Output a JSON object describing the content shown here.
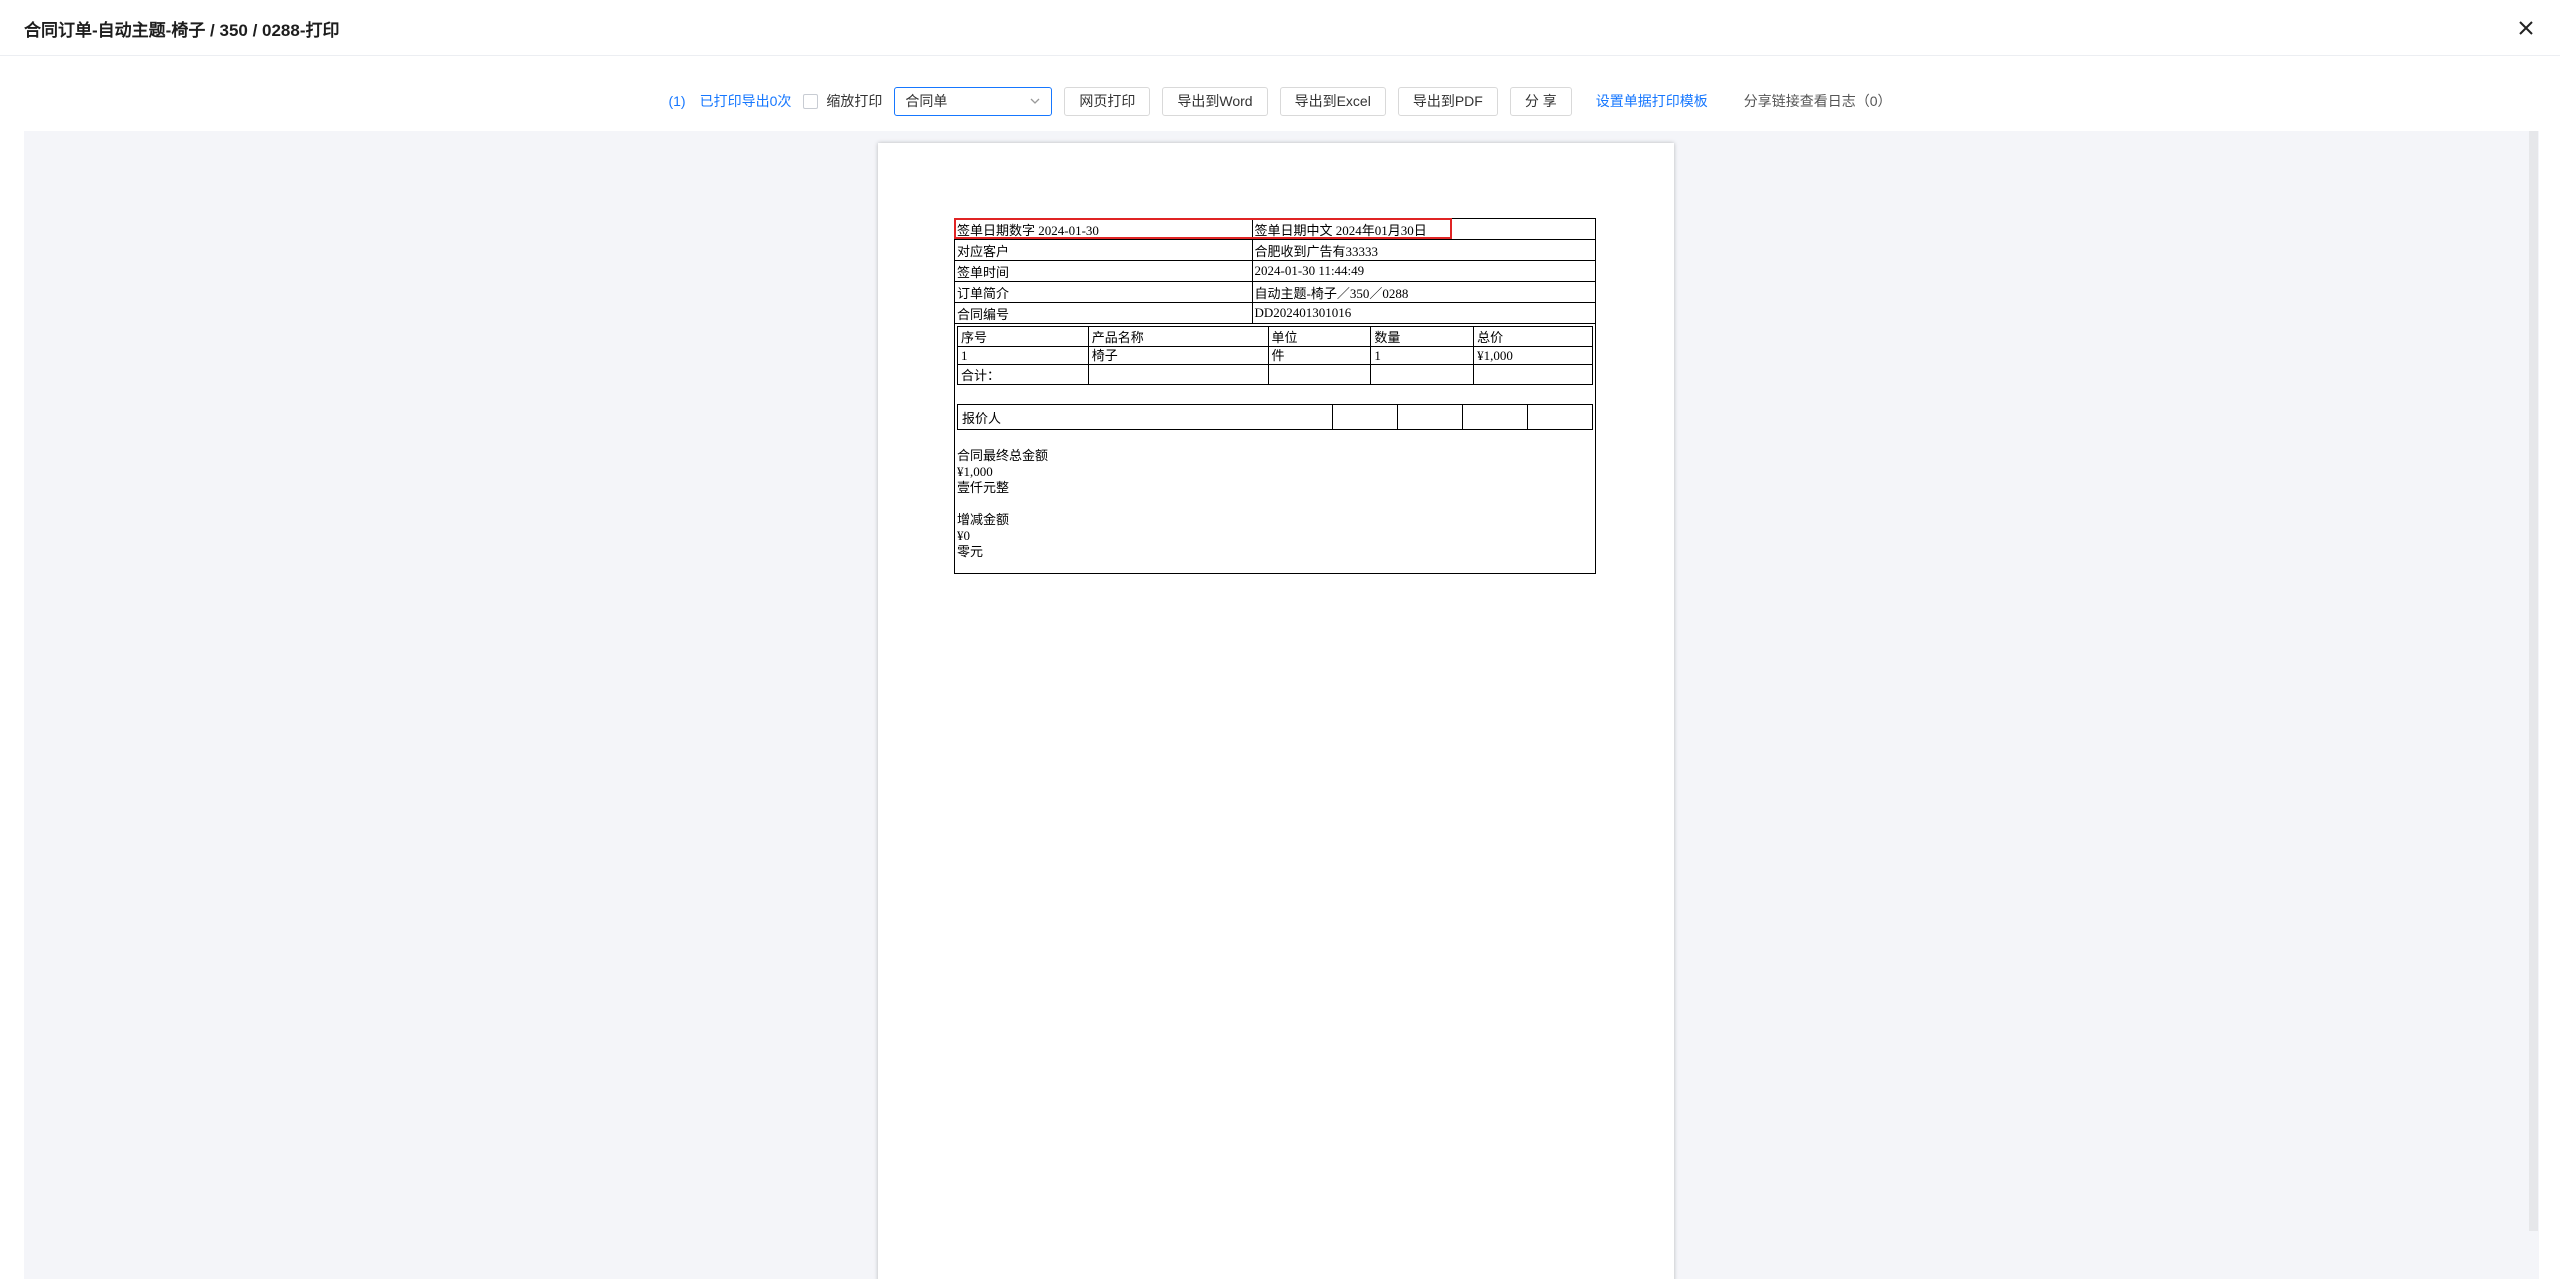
{
  "window": {
    "title": "合同订单-自动主题-椅子 / 350 / 0288-打印"
  },
  "toolbar": {
    "count_link": "(1)",
    "printed_link": "已打印导出0次",
    "scale_print_label": "缩放打印",
    "template_select_value": "合同单",
    "web_print": "网页打印",
    "export_word": "导出到Word",
    "export_excel": "导出到Excel",
    "export_pdf": "导出到PDF",
    "share": "分 享",
    "set_template": "设置单据打印模板",
    "share_log": "分享链接查看日志（0）"
  },
  "doc": {
    "header_rows": [
      {
        "label": "签单日期数字 2024-01-30",
        "value": "签单日期中文 2024年01月30日"
      },
      {
        "label": "对应客户",
        "value": "合肥收到广告有33333"
      },
      {
        "label": "签单时间",
        "value": "2024-01-30 11:44:49"
      },
      {
        "label": "订单简介",
        "value": "自动主题-椅子／350／0288"
      },
      {
        "label": "合同编号",
        "value": "DD202401301016"
      }
    ],
    "items_headers": [
      "序号",
      "产品名称",
      "单位",
      "数量",
      "总价"
    ],
    "items_row": [
      "1",
      "椅子",
      "件",
      "1",
      "¥1,000"
    ],
    "total_label": "合计：",
    "reporter_label": "报价人",
    "final_total_label": "合同最终总金额",
    "final_total_value": "¥1,000",
    "final_total_chinese": "壹仟元整",
    "adjust_label": "增减金额",
    "adjust_value": "¥0",
    "adjust_chinese": "零元"
  },
  "colors": {
    "accent": "#1677ff",
    "highlight": "#e02424",
    "preview_bg": "#f4f5f9"
  }
}
